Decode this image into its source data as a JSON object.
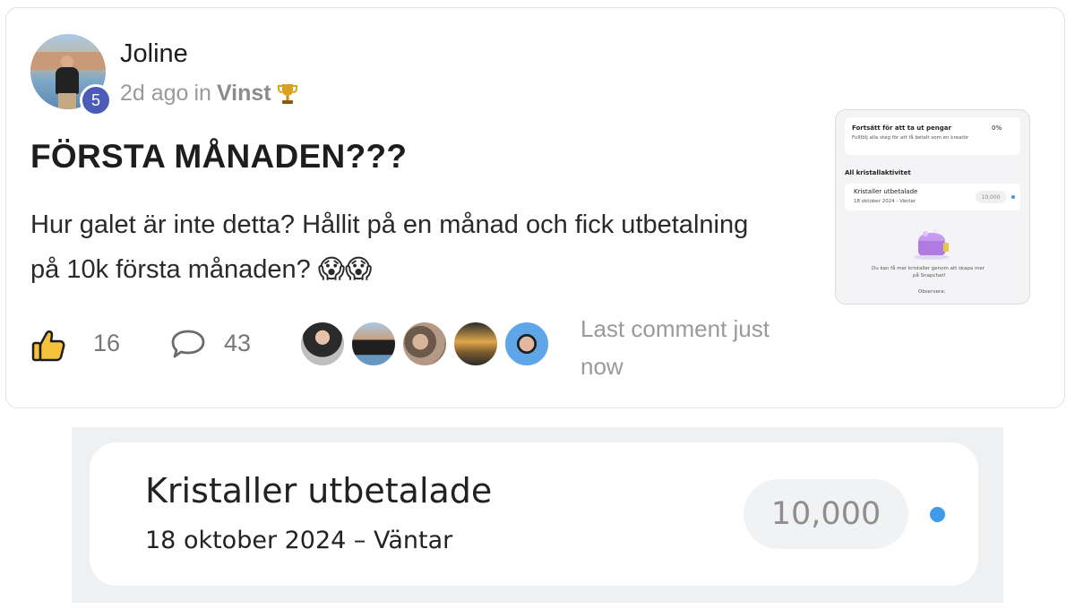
{
  "post": {
    "author": "Joline",
    "level": "5",
    "time": "2d ago",
    "in_word": "in",
    "category": "Vinst",
    "title": "FÖRSTA MÅNADEN???",
    "body": "Hur galet är inte detta? Hållit på en månad och fick utbetalning på 10k första månaden? 😱😱",
    "likes": "16",
    "comments": "43",
    "last_comment": "Last comment just now",
    "icons": [
      "trophy-icon",
      "thumbs-up-icon",
      "comment-bubble-icon"
    ]
  },
  "thumbnail": {
    "row1_title": "Fortsätt för att ta ut pengar",
    "row1_percent": "0%",
    "row1_sub": "Fullfölj alla steg för att få betalt som en kreatör",
    "section": "All kristallaktivitet",
    "item_title": "Kristaller utbetalade",
    "item_sub": "18 oktober 2024 - Väntar",
    "item_amount": "10,000",
    "info": "Du kan få mer kristaller genom att skapa mer",
    "info2": "på Snapchat!",
    "note": "Observera:"
  },
  "detail": {
    "title": "Kristaller utbetalade",
    "subtitle": "18 oktober 2024 – Väntar",
    "amount": "10,000",
    "status_color": "#3d9be9"
  },
  "colors": {
    "badge": "#4c5ab8",
    "accent_blue": "#3d9be9",
    "like_yellow": "#f5c23a"
  }
}
